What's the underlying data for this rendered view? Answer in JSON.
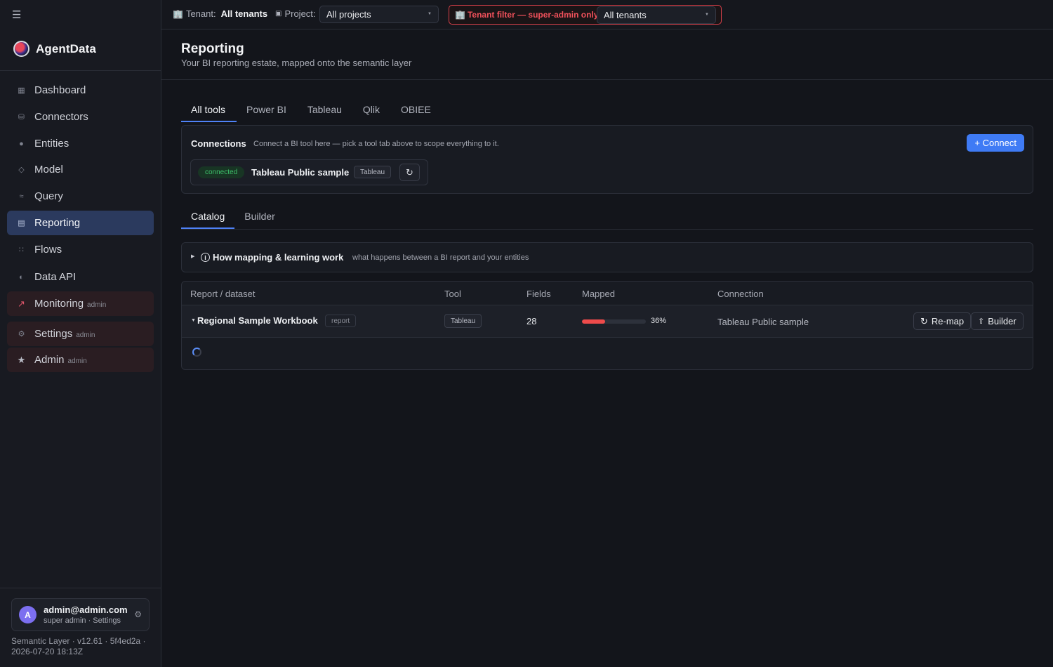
{
  "sidebar": {
    "brand": "AgentData",
    "items": [
      {
        "label": "Dashboard",
        "icon": "grid-icon"
      },
      {
        "label": "Connectors",
        "icon": "database-icon"
      },
      {
        "label": "Entities",
        "icon": "globe-icon"
      },
      {
        "label": "Model",
        "icon": "diamond-icon"
      },
      {
        "label": "Query",
        "icon": "wave-icon"
      },
      {
        "label": "Reporting",
        "icon": "report-icon",
        "active": true
      },
      {
        "label": "Flows",
        "icon": "flow-icon"
      },
      {
        "label": "Data API",
        "icon": "half-circle-icon"
      },
      {
        "label": "Monitoring",
        "icon": "chart-icon",
        "tag": "admin"
      },
      {
        "label": "Settings",
        "icon": "gear-icon",
        "tag": "admin"
      },
      {
        "label": "Admin",
        "icon": "star-icon",
        "tag": "admin"
      }
    ],
    "user": {
      "initial": "A",
      "email": "admin@admin.com",
      "role": "super admin · Settings"
    },
    "version": "Semantic Layer · v12.61 · 5f4ed2a · 2026-07-20 18:13Z"
  },
  "topbar": {
    "tenant_label": "Tenant:",
    "tenant_value": "All tenants",
    "project_label": "Project:",
    "project_value": "All projects",
    "filter_label": "Tenant filter — super-admin only",
    "filter_value": "All tenants"
  },
  "page": {
    "title": "Reporting",
    "subtitle": "Your BI reporting estate, mapped onto the semantic layer"
  },
  "tool_tabs": [
    "All tools",
    "Power BI",
    "Tableau",
    "Qlik",
    "OBIEE"
  ],
  "connections": {
    "title": "Connections",
    "description": "Connect a BI tool here — pick a tool tab above to scope everything to it.",
    "connect_button": "+ Connect",
    "card": {
      "status": "connected",
      "name": "Tableau Public sample",
      "tool": "Tableau"
    }
  },
  "view_tabs": [
    "Catalog",
    "Builder"
  ],
  "howto": {
    "title": "How mapping & learning work",
    "description": "what happens between a BI report and your entities"
  },
  "table": {
    "headers": [
      "Report / dataset",
      "Tool",
      "Fields",
      "Mapped",
      "Connection"
    ],
    "rows": [
      {
        "name": "Regional Sample Workbook",
        "type": "report",
        "tool": "Tableau",
        "fields": "28",
        "mapped_pct": 36,
        "mapped_label": "36%",
        "connection": "Tableau Public sample",
        "remap_label": "Re-map",
        "builder_label": "Builder"
      }
    ]
  },
  "colors": {
    "accent": "#3f7bf5",
    "danger": "#ee4b4b",
    "success": "#3ec06a"
  }
}
